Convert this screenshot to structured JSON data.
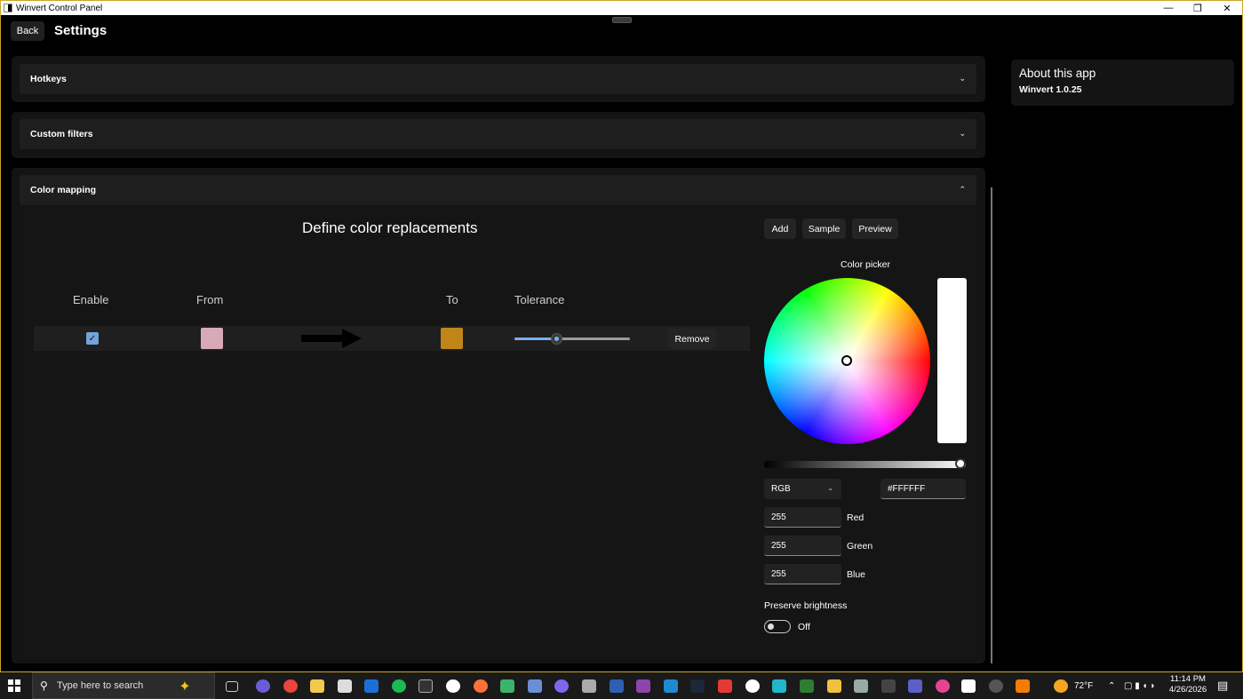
{
  "window": {
    "title": "Winvert Control Panel",
    "minimize": "—",
    "maximize": "❐",
    "close": "✕"
  },
  "header": {
    "back_label": "Back",
    "title": "Settings"
  },
  "sections": {
    "hotkeys": {
      "label": "Hotkeys",
      "chevron": "⌄"
    },
    "custom_filters": {
      "label": "Custom filters",
      "chevron": "⌄"
    },
    "color_mapping": {
      "label": "Color mapping",
      "chevron": "⌃"
    }
  },
  "about": {
    "heading": "About this app",
    "version": "Winvert 1.0.25"
  },
  "color_mapping": {
    "title": "Define color replacements",
    "buttons": {
      "add": "Add",
      "sample": "Sample",
      "preview": "Preview"
    },
    "columns": {
      "enable": "Enable",
      "from": "From",
      "to": "To",
      "tolerance": "Tolerance"
    },
    "rows": [
      {
        "enabled": true,
        "check": "✓",
        "from_color": "#d8aab7",
        "to_color": "#c0861a",
        "tolerance": 0.36,
        "remove_label": "Remove"
      }
    ]
  },
  "color_picker": {
    "label": "Color picker",
    "brightness": 1.0,
    "mode": "RGB",
    "mode_chevron": "⌄",
    "hex": "#FFFFFF",
    "red": {
      "value": "255",
      "label": "Red"
    },
    "green": {
      "value": "255",
      "label": "Green"
    },
    "blue": {
      "value": "255",
      "label": "Blue"
    },
    "preserve_brightness": {
      "label": "Preserve brightness",
      "state": "Off"
    }
  },
  "taskbar": {
    "search_placeholder": "Type here to search",
    "weather": "72°F",
    "time": "11:14 PM",
    "date": "4/26/2026"
  }
}
